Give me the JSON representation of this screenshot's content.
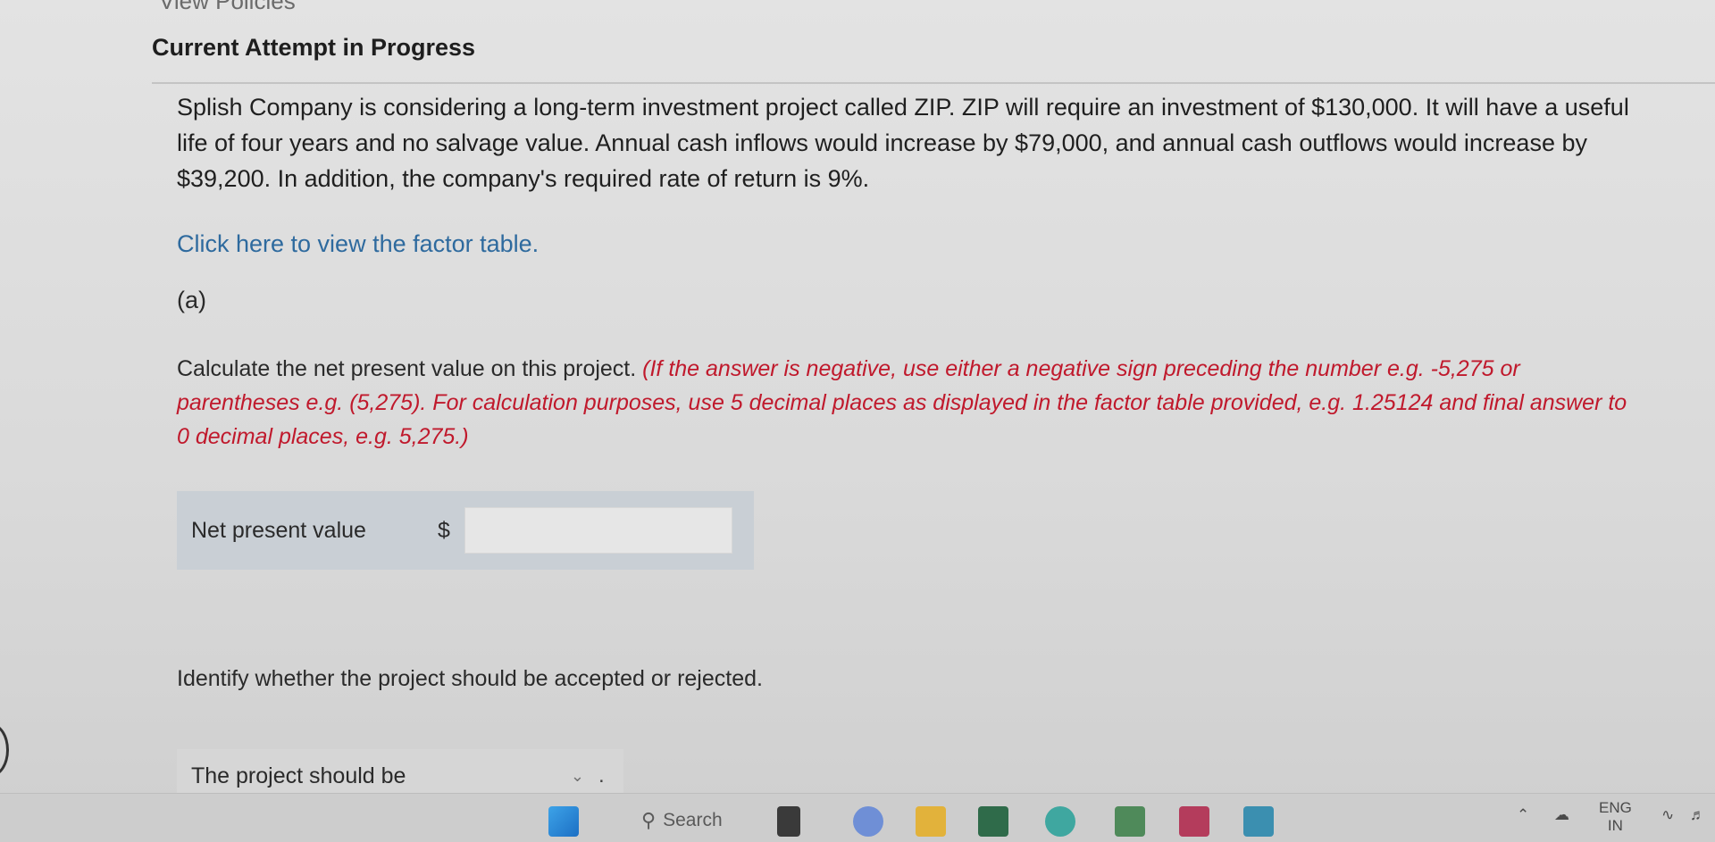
{
  "header": {
    "top_link": "View Policies",
    "title": "Current Attempt in Progress"
  },
  "problem": {
    "text": "Splish Company is considering a long-term investment project called ZIP. ZIP will require an investment of $130,000. It will have a useful life of four years and no salvage value. Annual cash inflows would increase by $79,000, and annual cash outflows would increase by $39,200. In addition, the company's required rate of return is 9%.",
    "factor_link": "Click here to view the factor table."
  },
  "part_a": {
    "label": "(a)",
    "instruction": "Calculate the net present value on this project.",
    "hint": "(If the answer is negative, use either a negative sign preceding the number e.g. -5,275 or parentheses e.g. (5,275). For calculation purposes, use 5 decimal places as displayed in the factor table provided, e.g. 1.25124 and final answer to 0 decimal places, e.g. 5,275.)",
    "npv_label": "Net present value",
    "currency": "$",
    "npv_value": ""
  },
  "decision": {
    "question": "Identify whether the project should be accepted or rejected.",
    "label": "The project should be",
    "selected": "",
    "trailing": "."
  },
  "taskbar": {
    "search_label": "Search",
    "search_icon": "search-icon",
    "lang_top": "ENG",
    "lang_bottom": "IN"
  },
  "colors": {
    "link": "#2e6a9e",
    "hint": "#c0192c",
    "panel": "#c9cfd5"
  }
}
